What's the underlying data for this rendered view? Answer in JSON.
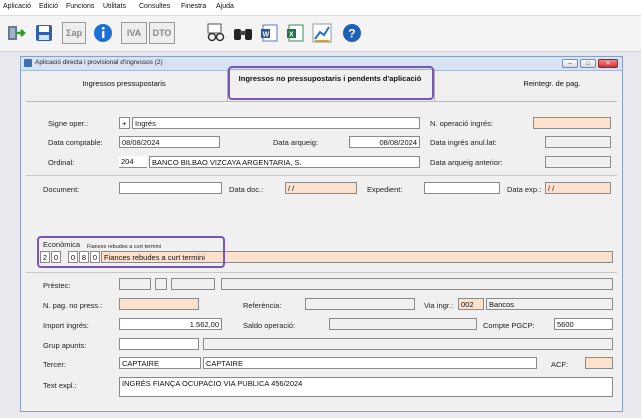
{
  "menu": [
    "Aplicació",
    "Edició",
    "Funcions",
    "Utilitats",
    "Consultes",
    "Finestra",
    "Ajuda"
  ],
  "toolbar": {
    "sum_label": "Σap",
    "iva_label": "IVA",
    "dto_label": "DTO",
    "help_label": "?"
  },
  "window": {
    "title": "Aplicació directa i provisional d'ingressos (2)",
    "min": "–",
    "max": "□",
    "close": "✕"
  },
  "tabs": {
    "tab1": "Ingressos pressupostaris",
    "tab2": "Ingressos no pressupostaris i pendents d'aplicació",
    "tab3": "Reintegr. de pag."
  },
  "form": {
    "signe_label": "Signe oper.:",
    "signe_sign": "+",
    "signe_value": "Ingrés",
    "noper_label": "N. operació ingrés:",
    "noper_value": "",
    "data_comptable_label": "Data comptable:",
    "data_comptable_value": "08/08/2024",
    "data_arqueig_label": "Data arqueig:",
    "data_arqueig_value": "08/08/2024",
    "data_ingres_anul_label": "Data ingrés anul.lat:",
    "ordinal_label": "Ordinal:",
    "ordinal_code": "204",
    "ordinal_name": "BANCO BILBAO VIZCAYA ARGENTARIA, S.",
    "data_arqueig_ant_label": "Data arqueig anterior:",
    "document_label": "Document:",
    "data_doc_label": "Data doc.:",
    "data_doc_value": "/ /",
    "expedient_label": "Expedient:",
    "data_exp_label": "Data exp.:",
    "data_exp_value": "/ /",
    "economica_label": "Econòmica",
    "economica_caption": "Fiances rebudes a curt termini",
    "eco_digit1": "2",
    "eco_digit2": "0",
    "eco_digit3": "0",
    "eco_digit4": "8",
    "eco_digit5": "0",
    "economica_desc": "Fiances rebudes a curt termini",
    "prestec_label": "Préstec:",
    "npag_label": "N. pag. no press.:",
    "referencia_label": "Referència:",
    "via_ingr_label": "Via ingr.:",
    "via_ingr_code": "002",
    "via_ingr_name": "Bancos",
    "import_label": "Import ingrés:",
    "import_value": "1.562,00",
    "saldo_label": "Saldo operació:",
    "compte_label": "Compte PGCP:",
    "compte_value": "5600",
    "grup_label": "Grup apunts:",
    "tercer_label": "Tercer:",
    "tercer_code": "CAPTAIRE",
    "tercer_name": "CAPTAIRE",
    "acf_label": "ACF:",
    "text_label": "Text expl.:",
    "text_value": "INGRÉS FIANÇA OCUPACIO VIA PUBLICA 456/2024"
  }
}
